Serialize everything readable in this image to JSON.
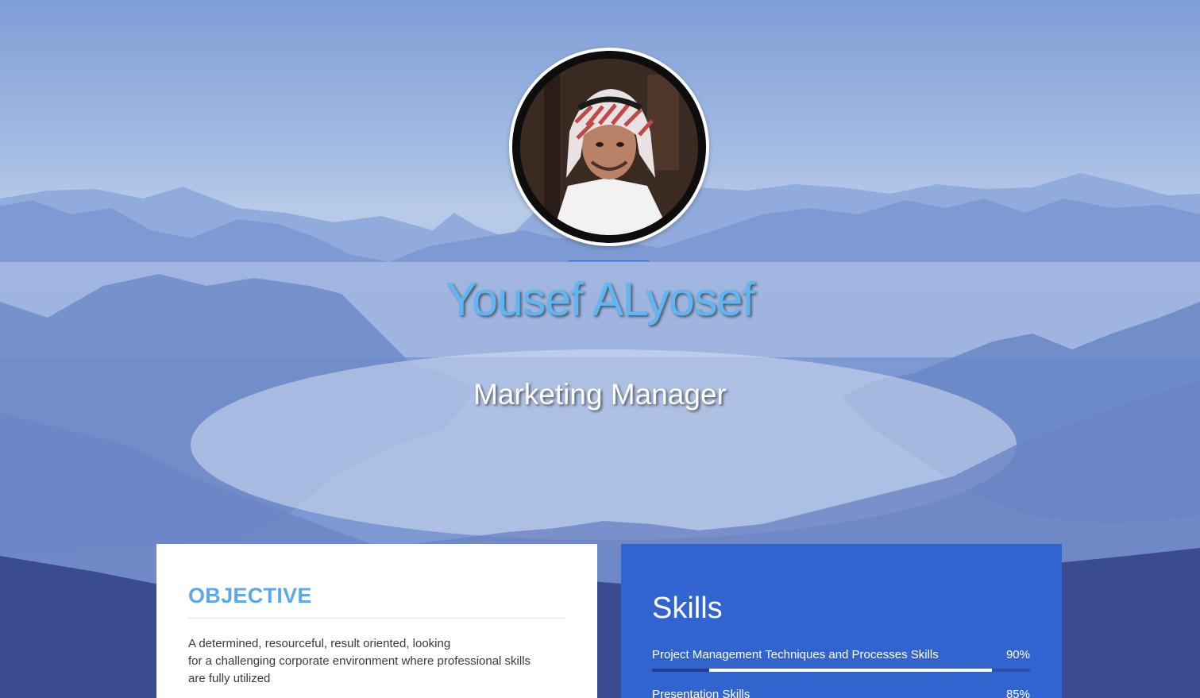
{
  "profile": {
    "name": "Yousef ALyosef",
    "title": "Marketing Manager",
    "photo_icon": "profile-photo"
  },
  "objective": {
    "heading": "OBJECTIVE",
    "lines": [
      "A determined, resourceful, result oriented, looking",
      "for a challenging corporate environment where professional skills",
      "are fully utilized"
    ]
  },
  "skills": {
    "heading": "Skills",
    "items": [
      {
        "name": "Project Management Techniques and Processes Skills",
        "percent_label": "90%",
        "level": 0.9
      },
      {
        "name": "Presentation Skills",
        "percent_label": "85%",
        "level": 0.85
      }
    ]
  },
  "colors": {
    "name_accent": "#5fb6f0",
    "objective_heading": "#5ea7ea",
    "skills_card": "#3264cf",
    "divider": "#2f63c6"
  }
}
